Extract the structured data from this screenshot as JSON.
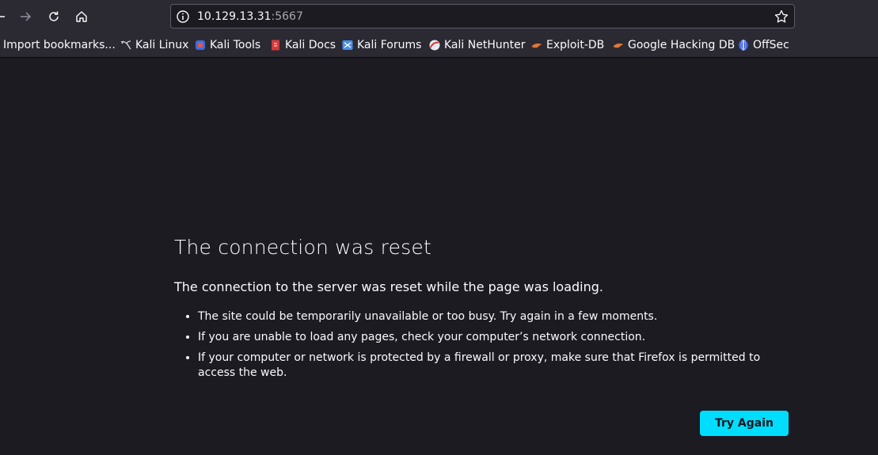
{
  "toolbar": {
    "url_host": "10.129.13.31",
    "url_port": ":5667",
    "icons": [
      "back-icon",
      "forward-icon",
      "reload-icon",
      "home-icon",
      "info-icon",
      "star-icon"
    ]
  },
  "bookmarks": {
    "import": "Import bookmarks...",
    "kali_linux": "Kali Linux",
    "kali_tools": "Kali Tools",
    "kali_docs": "Kali Docs",
    "kali_forums": "Kali Forums",
    "kali_nethunter": "Kali NetHunter",
    "exploit_db": "Exploit-DB",
    "ghdb": "Google Hacking DB",
    "offsec": "OffSec"
  },
  "error": {
    "title": "The connection was reset",
    "description": "The connection to the server was reset while the page was loading.",
    "items": [
      "The site could be temporarily unavailable or too busy. Try again in a few moments.",
      "If you are unable to load any pages, check your computer’s network connection.",
      "If your computer or network is protected by a firewall or proxy, make sure that Firefox is permitted to access the web."
    ],
    "button": "Try Again"
  },
  "colors": {
    "background": "#1c1b22",
    "toolbar": "#2b2a33",
    "accent": "#00ddff",
    "text": "#fbfbfe"
  }
}
